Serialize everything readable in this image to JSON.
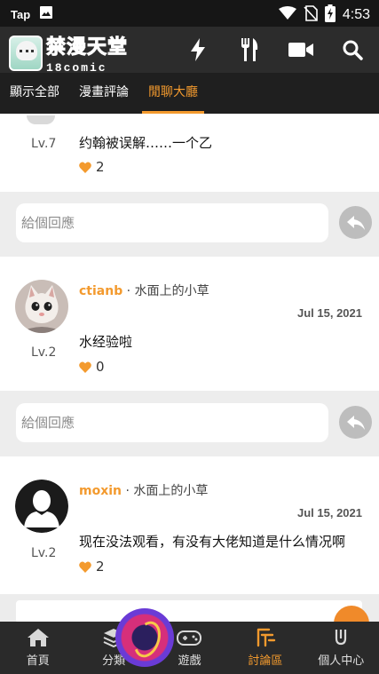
{
  "status_bar": {
    "carrier": "Tap",
    "time": "4:53"
  },
  "header": {
    "logo_main": "禁漫天堂",
    "logo_sub": "18comic"
  },
  "tabs": [
    {
      "label": "顯示全部",
      "active": false
    },
    {
      "label": "漫畫評論",
      "active": false
    },
    {
      "label": "閒聊大廳",
      "active": true
    }
  ],
  "comments": [
    {
      "level": "Lv.7",
      "text": "约翰被误解……一个乙",
      "likes": "2"
    },
    {
      "username": "ctianb",
      "separator": " · ",
      "forum": "水面上的小草",
      "date": "Jul 15, 2021",
      "level": "Lv.2",
      "text": "水经验啦",
      "likes": "0"
    },
    {
      "username": "moxin",
      "separator": " · ",
      "forum": "水面上的小草",
      "date": "Jul 15, 2021",
      "level": "Lv.2",
      "text": "现在没法观看，有没有大佬知道是什么情况啊",
      "likes": "2"
    }
  ],
  "reply": {
    "placeholder": "給個回應"
  },
  "bottom_nav": [
    {
      "label": "首頁",
      "icon": "home-icon",
      "active": false
    },
    {
      "label": "分類",
      "icon": "layers-icon",
      "active": false
    },
    {
      "label": "遊戲",
      "icon": "gamepad-icon",
      "active": false
    },
    {
      "label": "討論區",
      "icon": "forum-icon",
      "active": true
    },
    {
      "label": "個人中心",
      "icon": "profile-icon",
      "active": false
    }
  ],
  "colors": {
    "accent": "#f39a2e",
    "header_bg": "#2c2c2c",
    "tab_bg": "#1f1f1f",
    "nav_bg": "#2a2a2a"
  }
}
